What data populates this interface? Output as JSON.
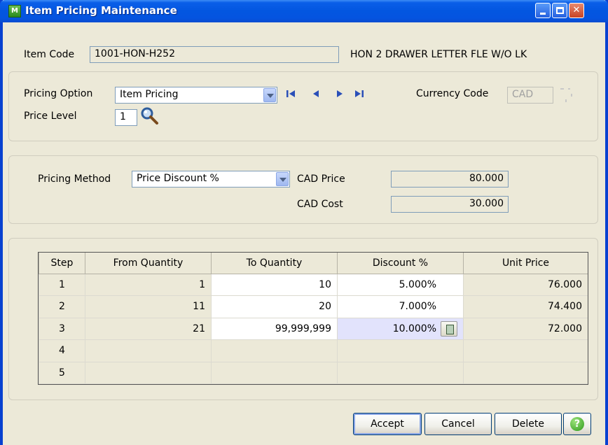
{
  "window": {
    "title": "Item Pricing Maintenance",
    "icon": "app-m-icon"
  },
  "item": {
    "code_label": "Item Code",
    "code_value": "1001-HON-H252",
    "description": "HON 2 DRAWER LETTER FLE W/O LK"
  },
  "pricing": {
    "option_label": "Pricing Option",
    "option_value": "Item Pricing",
    "level_label": "Price Level",
    "level_value": "1",
    "currency_label": "Currency Code",
    "currency_value": "CAD"
  },
  "method": {
    "label": "Pricing Method",
    "value": "Price Discount %",
    "price_label": "CAD Price",
    "price_value": "80.000",
    "cost_label": "CAD Cost",
    "cost_value": "30.000"
  },
  "grid": {
    "headers": [
      "Step",
      "From Quantity",
      "To Quantity",
      "Discount %",
      "Unit Price"
    ],
    "rows": [
      {
        "step": "1",
        "from": "1",
        "to": "10",
        "discount": "5.000%",
        "unit_price": "76.000"
      },
      {
        "step": "2",
        "from": "11",
        "to": "20",
        "discount": "7.000%",
        "unit_price": "74.400"
      },
      {
        "step": "3",
        "from": "21",
        "to": "99,999,999",
        "discount": "10.000%",
        "unit_price": "72.000"
      },
      {
        "step": "4",
        "from": "",
        "to": "",
        "discount": "",
        "unit_price": ""
      },
      {
        "step": "5",
        "from": "",
        "to": "",
        "discount": "",
        "unit_price": ""
      }
    ]
  },
  "buttons": {
    "accept": "Accept",
    "cancel": "Cancel",
    "delete": "Delete"
  },
  "colors": {
    "title_bar": "#0356e0",
    "window_bg": "#ece9d8",
    "active_cell": "#e2e3fc"
  }
}
